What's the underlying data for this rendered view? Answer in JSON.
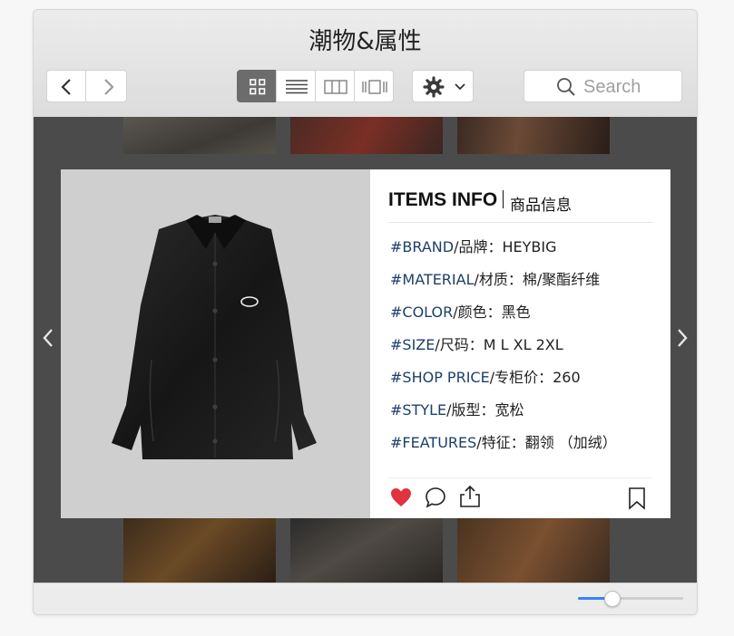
{
  "window": {
    "title": "潮物&属性"
  },
  "toolbar": {
    "view_modes": [
      "grid",
      "list",
      "columns",
      "cover-flow"
    ],
    "active_view": "grid",
    "search_placeholder": "Search"
  },
  "colors": {
    "accent": "#3b82f6",
    "tag": "#1d3f6a",
    "like": "#e0323f",
    "content_bg": "#4b4b4b"
  },
  "zoom_slider": {
    "fraction": 0.32
  },
  "card": {
    "title": "ITEMS INFO",
    "subtitle": "商品信息",
    "attributes": [
      {
        "tag": "#BRAND",
        "label": "/品牌：HEYBIG"
      },
      {
        "tag": "#MATERIAL",
        "label": "/材质：棉/聚酯纤维"
      },
      {
        "tag": "#COLOR",
        "label": "/颜色：黑色"
      },
      {
        "tag": "#SIZE",
        "label": "/尺码：M L XL 2XL"
      },
      {
        "tag": "#SHOP PRICE",
        "label": "/专柜价：260"
      },
      {
        "tag": "#STYLE",
        "label": "/版型：宽松"
      },
      {
        "tag": "#FEATURES",
        "label": "/特征：翻领 （加绒）"
      }
    ],
    "actions": [
      "heart-icon",
      "comment-icon",
      "share-icon",
      "bookmark-icon"
    ]
  }
}
